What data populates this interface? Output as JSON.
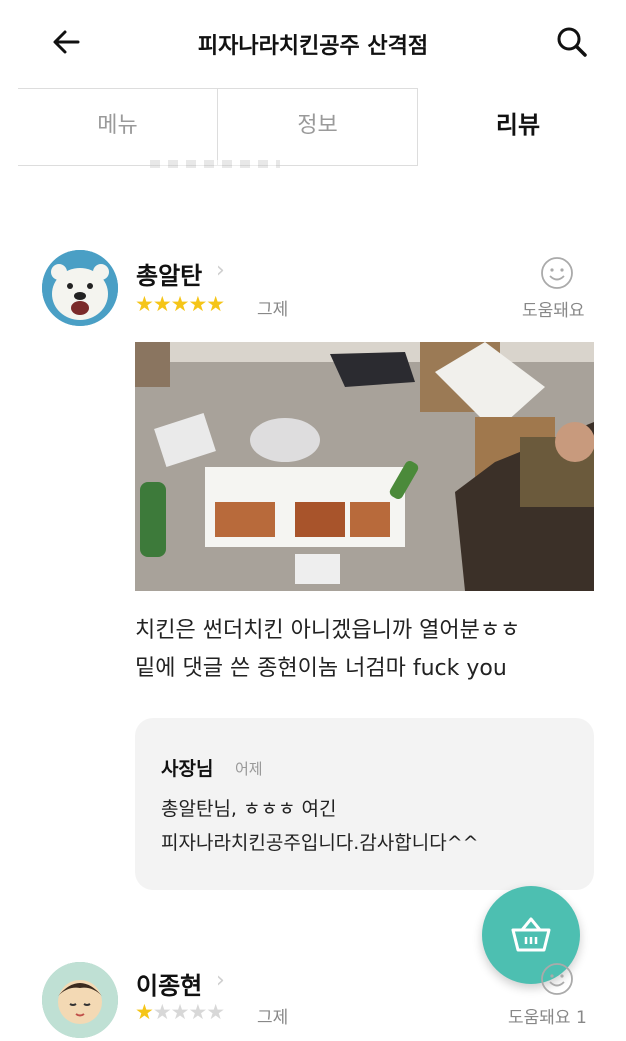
{
  "header": {
    "title": "피자나라치킨공주 산격점",
    "back_icon": "back-arrow-icon",
    "search_icon": "search-icon"
  },
  "tabs": [
    {
      "label": "메뉴",
      "active": false
    },
    {
      "label": "정보",
      "active": false
    },
    {
      "label": "리뷰",
      "active": true
    }
  ],
  "reviews": [
    {
      "user": "총알탄",
      "rating": 5,
      "date": "그제",
      "helpful_label": "도움돼요",
      "text_lines": [
        "치킨은 썬더치킨 아니겠읍니까 열어분ㅎㅎ",
        "밑에 댓글 쓴 종현이놈 너검마 fuck you"
      ],
      "reply": {
        "author": "사장님",
        "date": "어제",
        "text_lines": [
          "총알탄님, ㅎㅎㅎ 여긴",
          "피자나라치킨공주입니다.감사합니다^^"
        ]
      }
    },
    {
      "user": "이종현",
      "rating": 1,
      "date": "그제",
      "helpful_label": "도움돼요 1"
    }
  ],
  "fab": {
    "icon": "basket-icon",
    "color": "#4dbfb1"
  },
  "colors": {
    "star": "#f5c518",
    "star_off": "#d8d8d8",
    "accent": "#4dbfb1"
  }
}
